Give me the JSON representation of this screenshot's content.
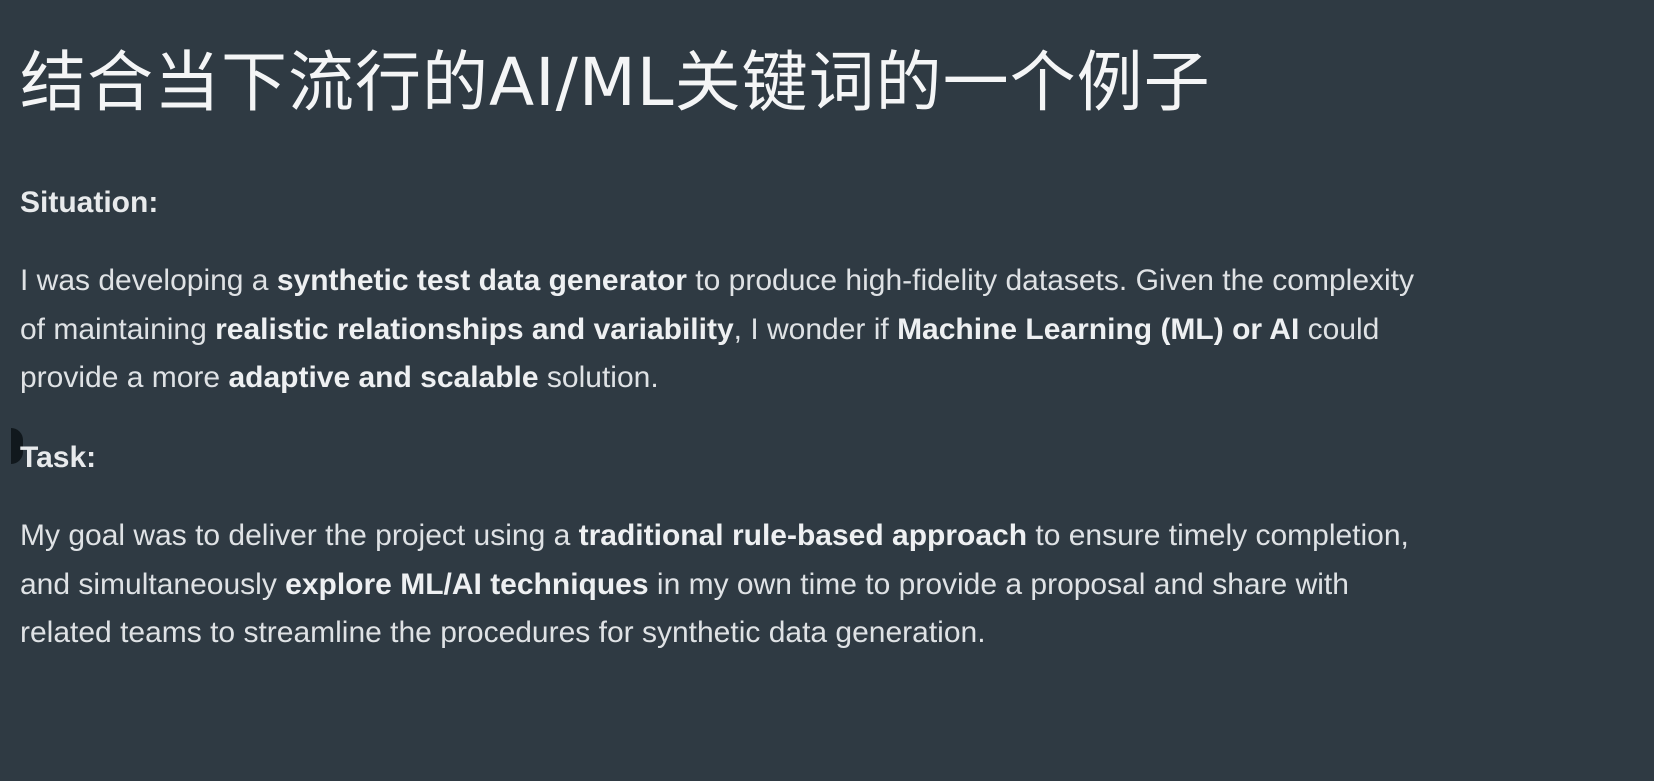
{
  "title": "结合当下流行的AI/ML关键词的一个例子",
  "situation": {
    "heading": "Situation:",
    "lines": [
      [
        {
          "text": "I was developing a ",
          "bold": false
        },
        {
          "text": "synthetic test data generator",
          "bold": true
        },
        {
          "text": " to produce high-fidelity datasets. Given the complexity",
          "bold": false
        }
      ],
      [
        {
          "text": "of maintaining ",
          "bold": false
        },
        {
          "text": "realistic relationships and variability",
          "bold": true
        },
        {
          "text": ", I wonder if ",
          "bold": false
        },
        {
          "text": "Machine Learning (ML) or AI",
          "bold": true
        },
        {
          "text": " could",
          "bold": false
        }
      ],
      [
        {
          "text": "provide a more ",
          "bold": false
        },
        {
          "text": "adaptive and scalable",
          "bold": true
        },
        {
          "text": " solution.",
          "bold": false
        }
      ]
    ]
  },
  "task": {
    "heading": "Task:",
    "lines": [
      [
        {
          "text": "My goal was to deliver the project using a ",
          "bold": false
        },
        {
          "text": "traditional rule-based approach",
          "bold": true
        },
        {
          "text": " to ensure timely completion,",
          "bold": false
        }
      ],
      [
        {
          "text": "and simultaneously ",
          "bold": false
        },
        {
          "text": "explore ML/AI techniques",
          "bold": true
        },
        {
          "text": " in my own time to provide a proposal and share with",
          "bold": false
        }
      ],
      [
        {
          "text": "related teams to streamline the procedures for synthetic data generation.",
          "bold": false
        }
      ]
    ]
  }
}
